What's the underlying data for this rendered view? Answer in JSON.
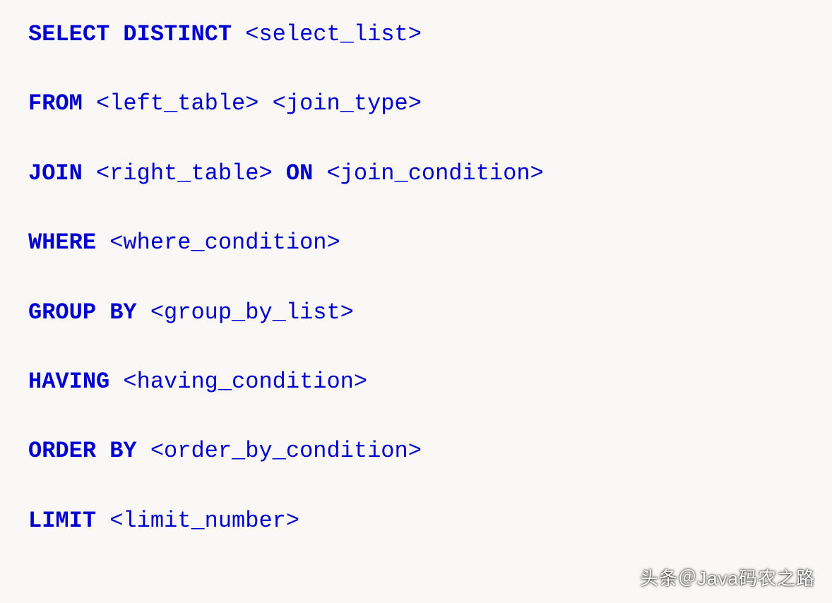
{
  "lines": [
    {
      "parts": [
        {
          "text": "SELECT",
          "type": "keyword"
        },
        {
          "text": " ",
          "type": "space"
        },
        {
          "text": "DISTINCT",
          "type": "keyword"
        },
        {
          "text": " ",
          "type": "space"
        },
        {
          "text": "<select_list>",
          "type": "placeholder"
        }
      ]
    },
    {
      "parts": [
        {
          "text": "FROM",
          "type": "keyword"
        },
        {
          "text": " ",
          "type": "space"
        },
        {
          "text": "<left_table>",
          "type": "placeholder"
        },
        {
          "text": " ",
          "type": "space"
        },
        {
          "text": "<join_type>",
          "type": "placeholder"
        }
      ]
    },
    {
      "parts": [
        {
          "text": "JOIN",
          "type": "keyword"
        },
        {
          "text": " ",
          "type": "space"
        },
        {
          "text": "<right_table>",
          "type": "placeholder"
        },
        {
          "text": " ",
          "type": "space"
        },
        {
          "text": "ON",
          "type": "keyword"
        },
        {
          "text": " ",
          "type": "space"
        },
        {
          "text": "<join_condition>",
          "type": "placeholder"
        }
      ]
    },
    {
      "parts": [
        {
          "text": "WHERE",
          "type": "keyword"
        },
        {
          "text": " ",
          "type": "space"
        },
        {
          "text": "<where_condition>",
          "type": "placeholder"
        }
      ]
    },
    {
      "parts": [
        {
          "text": "GROUP",
          "type": "keyword"
        },
        {
          "text": " ",
          "type": "space"
        },
        {
          "text": "BY",
          "type": "keyword"
        },
        {
          "text": " ",
          "type": "space"
        },
        {
          "text": "<group_by_list>",
          "type": "placeholder"
        }
      ]
    },
    {
      "parts": [
        {
          "text": "HAVING",
          "type": "keyword"
        },
        {
          "text": " ",
          "type": "space"
        },
        {
          "text": "<having_condition>",
          "type": "placeholder"
        }
      ]
    },
    {
      "parts": [
        {
          "text": "ORDER",
          "type": "keyword"
        },
        {
          "text": " ",
          "type": "space"
        },
        {
          "text": "BY",
          "type": "keyword"
        },
        {
          "text": " ",
          "type": "space"
        },
        {
          "text": "<order_by_condition>",
          "type": "placeholder"
        }
      ]
    },
    {
      "parts": [
        {
          "text": "LIMIT",
          "type": "keyword"
        },
        {
          "text": " ",
          "type": "space"
        },
        {
          "text": "<limit_number>",
          "type": "placeholder"
        }
      ]
    }
  ],
  "watermark": "头条＠Java码农之路"
}
